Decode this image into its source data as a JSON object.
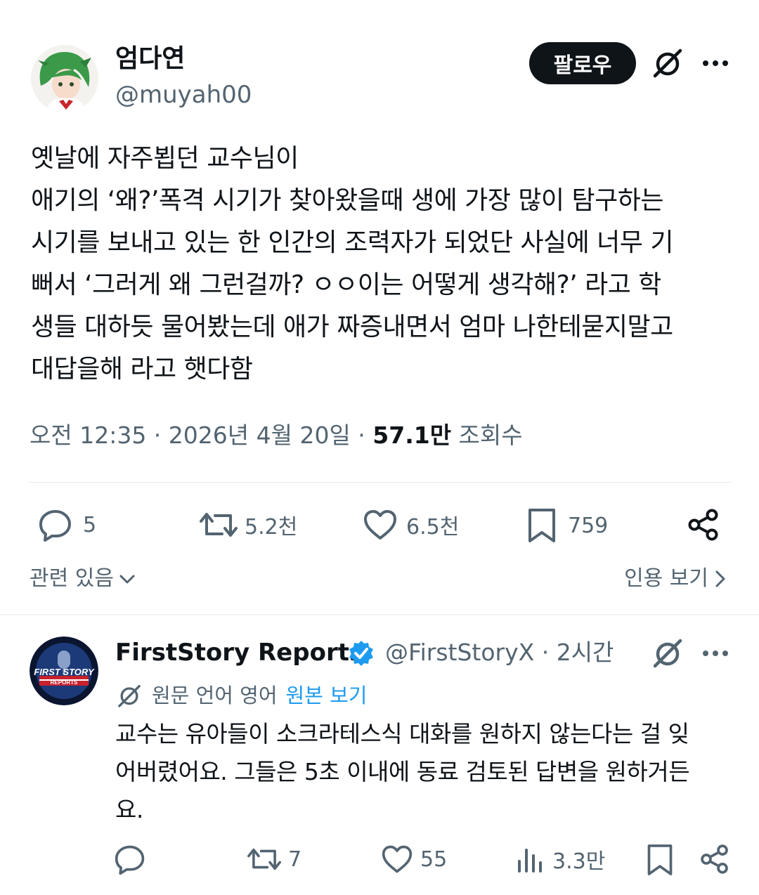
{
  "tweet": {
    "author": {
      "display_name": "엄다연",
      "handle": "@muyah00"
    },
    "follow_label": "팔로우",
    "body_lines": [
      "옛날에 자주뵙던 교수님이",
      "애기의 ‘왜?’폭격 시기가 찾아왔을때 생에 가장 많이 탐구하는",
      "시기를 보내고 있는 한 인간의 조력자가 되었단 사실에 너무 기",
      "뻐서 ‘그러게 왜 그런걸까? ㅇㅇ이는 어떻게 생각해?’ 라고 학",
      "생들 대하듯 물어봤는데 애가 짜증내면서 엄마 나한테묻지말고",
      "대답을해 라고 햇다함"
    ],
    "timestamp": "오전 12:35 · 2026년 4월 20일 · ",
    "views_count": "57.1만",
    "views_label": " 조회수",
    "actions": {
      "replies": "5",
      "reposts": "5.2천",
      "likes": "6.5천",
      "bookmarks": "759"
    },
    "related_label": "관련 있음",
    "quotes_label": "인용 보기"
  },
  "reply": {
    "display_name": "FirstStory Reports",
    "handle_time": "@FirstStoryX · 2시간",
    "translation_note": "원문 언어 영어",
    "show_original": "원본 보기",
    "body_lines": [
      "교수는 유아들이 소크라테스식 대화를 원하지 않는다는 걸 잊",
      "어버렸어요. 그들은 5초 이내에 동료 검토된 답변을 원하거든",
      "요."
    ],
    "actions": {
      "replies": "",
      "reposts": "7",
      "likes": "55",
      "views": "3.3만"
    },
    "avatar_text_top": "FIRST STORY",
    "avatar_text_bottom": "REPORTS"
  },
  "colors": {
    "text": "#0f1419",
    "muted": "#536471",
    "link": "#1d9bf0",
    "verified": "#1d9bf0"
  }
}
